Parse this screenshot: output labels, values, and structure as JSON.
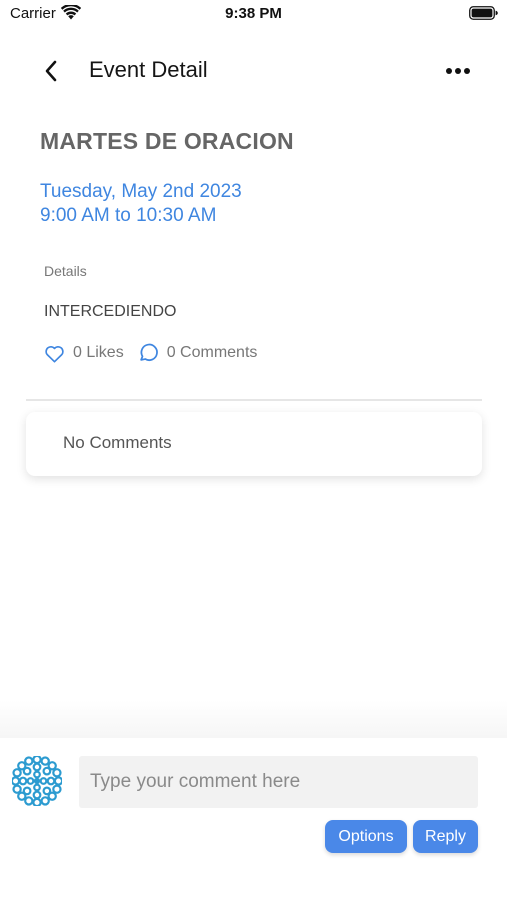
{
  "status_bar": {
    "carrier": "Carrier",
    "time": "9:38 PM",
    "icons": [
      "wifi-icon",
      "battery-icon"
    ]
  },
  "nav": {
    "title": "Event Detail",
    "back_icon": "chevron-left-icon",
    "more_icon": "ellipsis-horizontal-icon"
  },
  "event": {
    "title": "MARTES DE ORACION",
    "date": "Tuesday, May 2nd 2023",
    "time": "9:00 AM to 10:30 AM",
    "details_label": "Details",
    "details_text": "INTERCEDIENDO"
  },
  "reactions": {
    "likes_label": "0 Likes",
    "comments_label": "0 Comments",
    "likes_icon": "heart-outline-icon",
    "comments_icon": "speech-bubble-icon"
  },
  "comments": {
    "empty_text": "No Comments"
  },
  "composer": {
    "avatar_icon": "flower-avatar-icon",
    "placeholder": "Type your comment here",
    "value": "",
    "options_label": "Options",
    "reply_label": "Reply"
  },
  "colors": {
    "accent_blue": "#3f86e0",
    "button_blue": "#4a88e8",
    "avatar_blue": "#2c9bd0",
    "title_gray": "#666666"
  }
}
